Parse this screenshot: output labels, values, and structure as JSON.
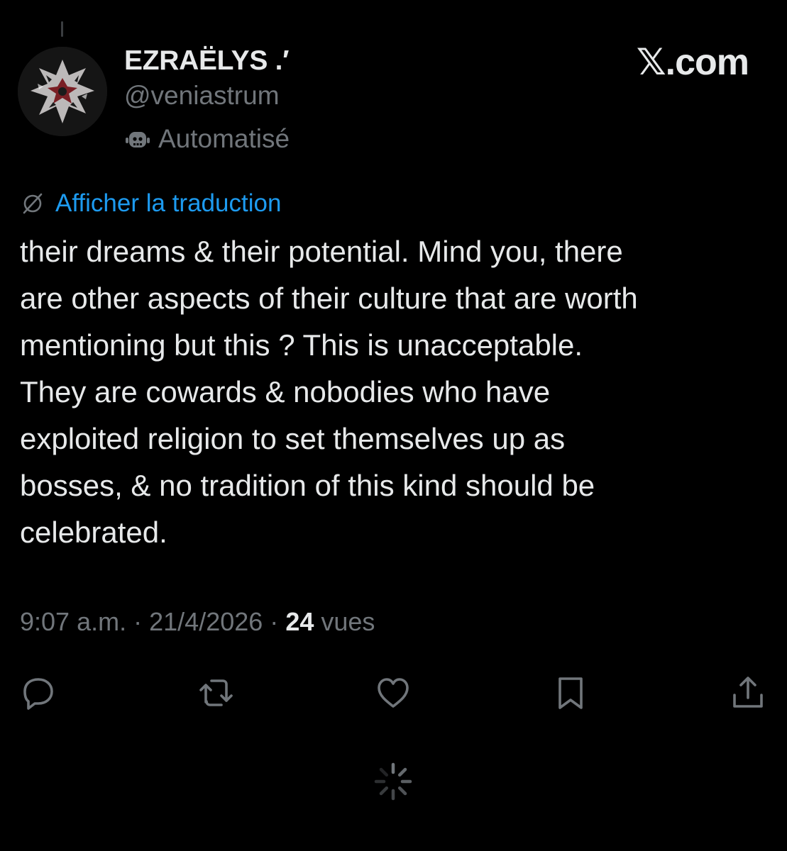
{
  "author": {
    "display_name": "EZRAËLYS .′",
    "handle": "@veniastrum",
    "automated_label": "Automatisé",
    "automated_icon": "bot-icon"
  },
  "brand": "𝕏.com",
  "translation": {
    "label": "Afficher la traduction",
    "icon": "translate-globe-icon"
  },
  "tweet": {
    "lines": [
      "their dreams & their potential. Mind you, there",
      "are other aspects of their culture that are worth",
      "mentioning but this ? This is unacceptable.",
      "They are cowards & nobodies who have",
      "exploited religion to set themselves up as",
      "bosses, & no tradition of this kind should be",
      "celebrated."
    ]
  },
  "meta": {
    "time": "9:07 a.m.",
    "separator": "·",
    "date": "21/4/2026",
    "views_count": "24",
    "views_label": "vues"
  },
  "actions": [
    {
      "name": "reply",
      "icon": "reply-icon"
    },
    {
      "name": "repost",
      "icon": "repost-icon"
    },
    {
      "name": "like",
      "icon": "heart-icon"
    },
    {
      "name": "bookmark",
      "icon": "bookmark-icon"
    },
    {
      "name": "share",
      "icon": "share-icon"
    }
  ],
  "colors": {
    "background": "#000000",
    "text": "#e7e9ea",
    "secondary": "#71767b",
    "link": "#1d9bf0"
  }
}
